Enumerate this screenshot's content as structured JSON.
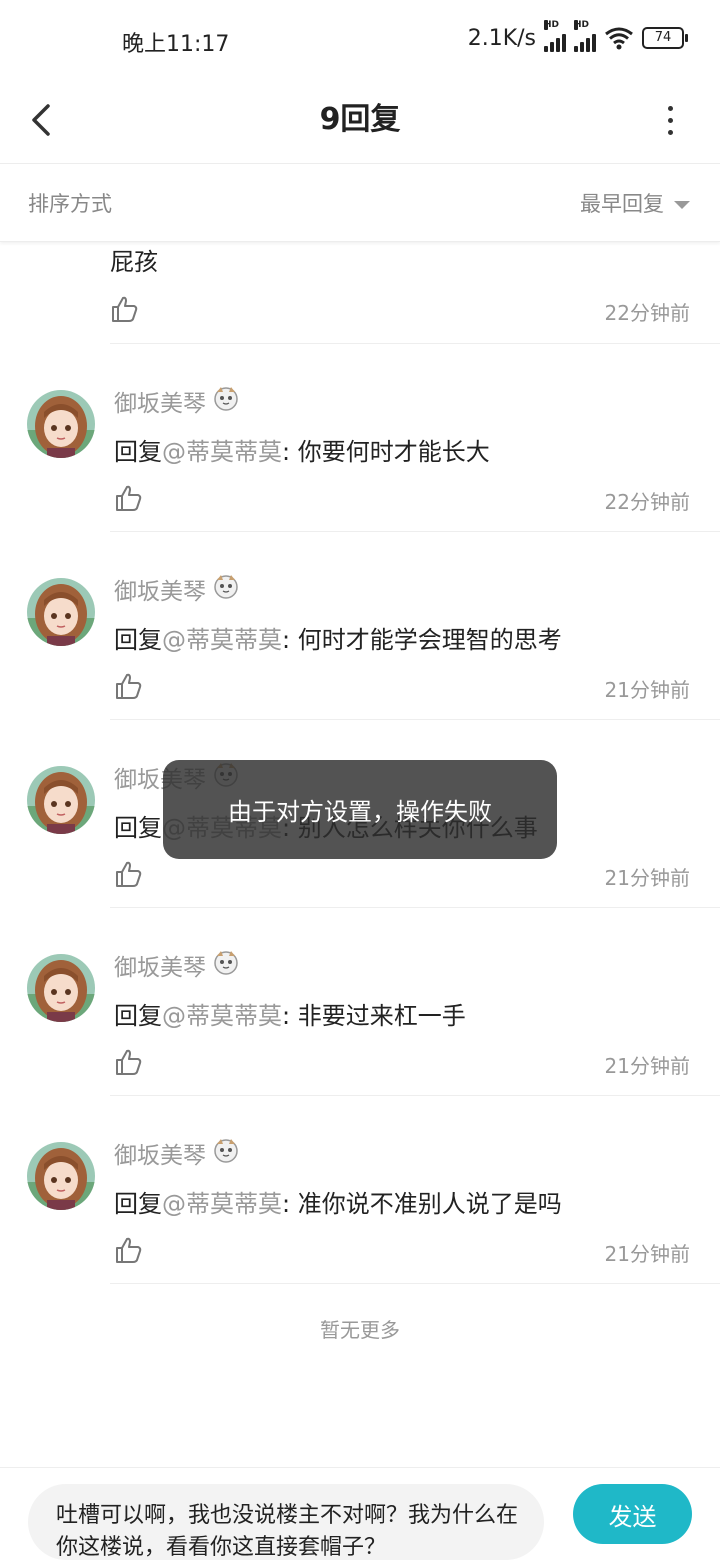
{
  "status_bar": {
    "time": "晚上11:17",
    "speed": "2.1K/s",
    "signal_label": "HD",
    "battery": "74"
  },
  "header": {
    "title": "9回复"
  },
  "sort": {
    "label": "排序方式",
    "value": "最早回复"
  },
  "partial_comment": {
    "text": "屁孩",
    "time": "22分钟前"
  },
  "comments": [
    {
      "username": "御坂美琴",
      "prefix": "回复",
      "mention": "@蒂莫蒂莫",
      "text": ": 你要何时才能长大",
      "time": "22分钟前"
    },
    {
      "username": "御坂美琴",
      "prefix": "回复",
      "mention": "@蒂莫蒂莫",
      "text": ": 何时才能学会理智的思考",
      "time": "21分钟前"
    },
    {
      "username": "御坂美琴",
      "prefix": "回复",
      "mention": "@蒂莫蒂莫",
      "text": ": 别人怎么样关你什么事",
      "time": "21分钟前"
    },
    {
      "username": "御坂美琴",
      "prefix": "回复",
      "mention": "@蒂莫蒂莫",
      "text": ": 非要过来杠一手",
      "time": "21分钟前"
    },
    {
      "username": "御坂美琴",
      "prefix": "回复",
      "mention": "@蒂莫蒂莫",
      "text": ": 准你说不准别人说了是吗",
      "time": "21分钟前"
    }
  ],
  "no_more": "暂无更多",
  "toast": "由于对方设置，操作失败",
  "composer": {
    "text": "吐槽可以啊，我也没说楼主不对啊？我为什么在你这楼说，看看你这直接套帽子？",
    "send_label": "发送"
  },
  "colors": {
    "accent": "#1fb8c8",
    "muted": "#999999"
  }
}
